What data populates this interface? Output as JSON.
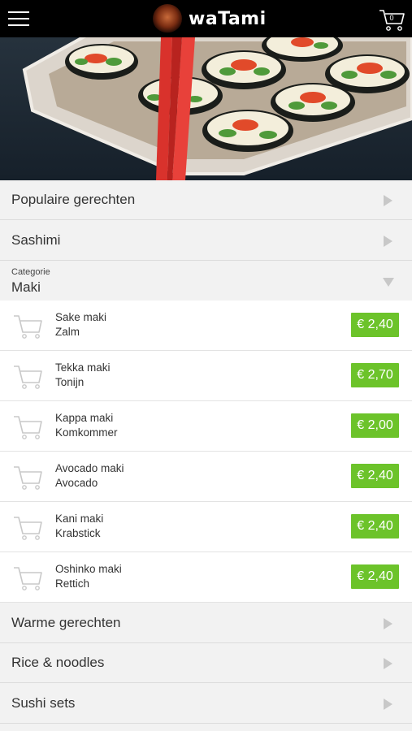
{
  "header": {
    "brand_name": "waTami",
    "cart_count": "0",
    "icons": {
      "menu": "hamburger-icon",
      "cart": "cart-icon"
    }
  },
  "categories_top": [
    {
      "label": "Populaire gerechten"
    },
    {
      "label": "Sashimi"
    }
  ],
  "open_category": {
    "caption": "Categorie",
    "label": "Maki",
    "items": [
      {
        "name": "Sake maki",
        "sub": "Zalm",
        "price": "€ 2,40"
      },
      {
        "name": "Tekka maki",
        "sub": "Tonijn",
        "price": "€ 2,70"
      },
      {
        "name": "Kappa maki",
        "sub": "Komkommer",
        "price": "€ 2,00"
      },
      {
        "name": "Avocado maki",
        "sub": "Avocado",
        "price": "€ 2,40"
      },
      {
        "name": "Kani maki",
        "sub": "Krabstick",
        "price": "€ 2,40"
      },
      {
        "name": "Oshinko maki",
        "sub": "Rettich",
        "price": "€ 2,40"
      }
    ]
  },
  "categories_bottom": [
    {
      "label": "Warme gerechten"
    },
    {
      "label": "Rice & noodles"
    },
    {
      "label": "Sushi sets"
    }
  ],
  "colors": {
    "accent": "#6cc32a",
    "topbar": "#000000",
    "background": "#f2f2f2"
  }
}
